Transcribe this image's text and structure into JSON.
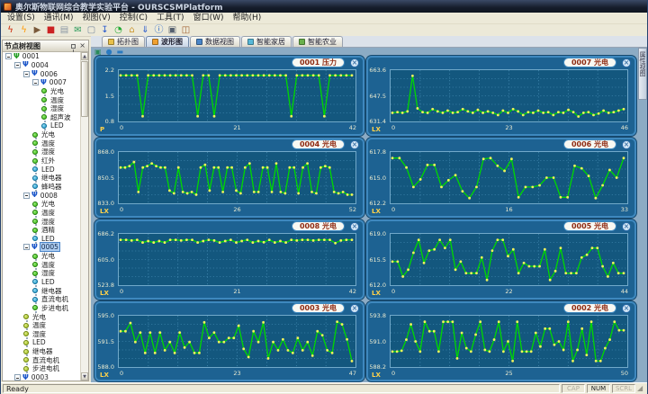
{
  "window": {
    "title": "奥尔斯物联网综合教学实验平台 - OURSCSMPlatform"
  },
  "menu_bar": {
    "items": [
      "设置(S)",
      "通讯(M)",
      "视图(V)",
      "控制(C)",
      "工具(T)",
      "窗口(W)",
      "帮助(H)"
    ]
  },
  "toolbar": {
    "icons": [
      {
        "name": "lightning-red-icon",
        "glyph": "ϟ",
        "color": "#cc2200"
      },
      {
        "name": "lightning-orange-icon",
        "glyph": "ϟ",
        "color": "#ff9900"
      },
      {
        "name": "play-icon",
        "glyph": "▶",
        "color": "#7a5a3a"
      },
      {
        "name": "stop-icon",
        "glyph": "■",
        "color": "#cc2222"
      },
      {
        "name": "cascade-windows-icon",
        "glyph": "▤",
        "color": "#8a96a4"
      },
      {
        "name": "mail-icon",
        "glyph": "✉",
        "color": "#2a9a5a"
      },
      {
        "name": "window-icon",
        "glyph": "▢",
        "color": "#7a8aa0"
      },
      {
        "name": "download-icon",
        "glyph": "↧",
        "color": "#2255cc"
      },
      {
        "name": "clock-icon",
        "glyph": "◔",
        "color": "#22aa33"
      },
      {
        "name": "home-icon",
        "glyph": "⌂",
        "color": "#cc9933"
      },
      {
        "name": "arrow-down-icon",
        "glyph": "⇓",
        "color": "#2255cc"
      },
      {
        "name": "info-icon",
        "glyph": "ⓘ",
        "color": "#2266cc"
      },
      {
        "name": "monitor-icon",
        "glyph": "▣",
        "color": "#55606e"
      },
      {
        "name": "exit-icon",
        "glyph": "◫",
        "color": "#a06030"
      }
    ]
  },
  "tabs": {
    "items": [
      {
        "label": "拓扑图",
        "active": false,
        "icon_name": "topology-tab-icon",
        "icon_color": "#e8c04a"
      },
      {
        "label": "波形图",
        "active": true,
        "icon_name": "waveform-tab-icon",
        "icon_color": "#f0a030"
      },
      {
        "label": "数据视图",
        "active": false,
        "icon_name": "dataview-tab-icon",
        "icon_color": "#4a86c8"
      },
      {
        "label": "智能家居",
        "active": false,
        "icon_name": "smarthome-tab-icon",
        "icon_color": "#58b8d8"
      },
      {
        "label": "智能农业",
        "active": false,
        "icon_name": "agriculture-tab-icon",
        "icon_color": "#6ab04c"
      }
    ]
  },
  "chart_toolbar": {
    "icons": [
      {
        "name": "display-icon",
        "glyph": "▣",
        "color": "#2a8a5a"
      },
      {
        "name": "globe-icon",
        "glyph": "●",
        "color": "#2a7ac0"
      },
      {
        "name": "collapse-icon",
        "glyph": "▬",
        "color": "#2a7ac0"
      }
    ]
  },
  "right_tab": {
    "label": "属性视图"
  },
  "tree": {
    "title": "节点树视图",
    "rows": [
      {
        "type": "node",
        "label": "0001",
        "level": 0,
        "icon": "antenna-green",
        "selected": false
      },
      {
        "type": "node",
        "label": "0004",
        "level": 1,
        "icon": "antenna-blue",
        "selected": false
      },
      {
        "type": "node",
        "label": "0006",
        "level": 2,
        "icon": "antenna-blue",
        "selected": false
      },
      {
        "type": "node",
        "label": "0007",
        "level": 3,
        "icon": "antenna-blue",
        "selected": false
      },
      {
        "type": "leaf",
        "label": "光电",
        "level": 4,
        "icon": "green"
      },
      {
        "type": "leaf",
        "label": "温度",
        "level": 4,
        "icon": "green"
      },
      {
        "type": "leaf",
        "label": "湿度",
        "level": 4,
        "icon": "green"
      },
      {
        "type": "leaf",
        "label": "超声波",
        "level": 4,
        "icon": "green"
      },
      {
        "type": "leaf",
        "label": "LED",
        "level": 4,
        "icon": "blue"
      },
      {
        "type": "leaf",
        "label": "光电",
        "level": 3,
        "icon": "green"
      },
      {
        "type": "leaf",
        "label": "温度",
        "level": 3,
        "icon": "green"
      },
      {
        "type": "leaf",
        "label": "湿度",
        "level": 3,
        "icon": "green"
      },
      {
        "type": "leaf",
        "label": "红外",
        "level": 3,
        "icon": "green"
      },
      {
        "type": "leaf",
        "label": "LED",
        "level": 3,
        "icon": "blue"
      },
      {
        "type": "leaf",
        "label": "继电器",
        "level": 3,
        "icon": "blue"
      },
      {
        "type": "leaf",
        "label": "蜂鸣器",
        "level": 3,
        "icon": "blue"
      },
      {
        "type": "node",
        "label": "0008",
        "level": 2,
        "icon": "antenna-blue",
        "selected": false
      },
      {
        "type": "leaf",
        "label": "光电",
        "level": 3,
        "icon": "green"
      },
      {
        "type": "leaf",
        "label": "温度",
        "level": 3,
        "icon": "green"
      },
      {
        "type": "leaf",
        "label": "湿度",
        "level": 3,
        "icon": "green"
      },
      {
        "type": "leaf",
        "label": "酒精",
        "level": 3,
        "icon": "green"
      },
      {
        "type": "leaf",
        "label": "LED",
        "level": 3,
        "icon": "blue"
      },
      {
        "type": "node",
        "label": "0005",
        "level": 2,
        "icon": "antenna-blue",
        "selected": true
      },
      {
        "type": "leaf",
        "label": "光电",
        "level": 3,
        "icon": "green"
      },
      {
        "type": "leaf",
        "label": "温度",
        "level": 3,
        "icon": "green"
      },
      {
        "type": "leaf",
        "label": "湿度",
        "level": 3,
        "icon": "green"
      },
      {
        "type": "leaf",
        "label": "LED",
        "level": 3,
        "icon": "blue"
      },
      {
        "type": "leaf",
        "label": "继电器",
        "level": 3,
        "icon": "blue"
      },
      {
        "type": "leaf",
        "label": "直流电机",
        "level": 3,
        "icon": "blue"
      },
      {
        "type": "leaf",
        "label": "步进电机",
        "level": 3,
        "icon": "green"
      },
      {
        "type": "leaf",
        "label": "光电",
        "level": 2,
        "icon": "yellow"
      },
      {
        "type": "leaf",
        "label": "温度",
        "level": 2,
        "icon": "yellow"
      },
      {
        "type": "leaf",
        "label": "湿度",
        "level": 2,
        "icon": "yellow"
      },
      {
        "type": "leaf",
        "label": "LED",
        "level": 2,
        "icon": "yellow"
      },
      {
        "type": "leaf",
        "label": "继电器",
        "level": 2,
        "icon": "yellow"
      },
      {
        "type": "leaf",
        "label": "直流电机",
        "level": 2,
        "icon": "yellow"
      },
      {
        "type": "leaf",
        "label": "步进电机",
        "level": 2,
        "icon": "yellow"
      },
      {
        "type": "node",
        "label": "0003",
        "level": 1,
        "icon": "antenna-blue",
        "selected": false
      }
    ]
  },
  "status_bar": {
    "left": "Ready",
    "indicators": [
      {
        "label": "CAP",
        "on": false
      },
      {
        "label": "NUM",
        "on": true
      },
      {
        "label": "SCRL",
        "on": false
      }
    ]
  },
  "chart_data": {
    "type": "line",
    "grid": true,
    "line_color": "#00d800",
    "marker_color": "#eef25c",
    "charts": [
      {
        "title": "0001 压力",
        "unit": "P",
        "ylim": [
          0.8,
          2.2
        ],
        "ytick_labels": [
          "2.2",
          "1.5",
          "0.8"
        ],
        "xtick_labels": [
          "0",
          "21",
          "42"
        ],
        "values": [
          2.1,
          2.1,
          2.1,
          2.1,
          0.9,
          2.1,
          2.1,
          2.1,
          2.1,
          2.1,
          2.1,
          2.1,
          2.1,
          2.1,
          0.9,
          2.1,
          2.1,
          0.9,
          2.1,
          2.1,
          2.1,
          2.1,
          2.1,
          2.1,
          2.1,
          2.1,
          2.1,
          2.1,
          2.1,
          2.1,
          2.1,
          0.9,
          2.1,
          2.1,
          2.1,
          2.1,
          2.1,
          0.9,
          2.1,
          2.1,
          2.1,
          2.1,
          2.1
        ]
      },
      {
        "title": "0007 光电",
        "unit": "LX",
        "ylim": [
          631.4,
          663.6
        ],
        "ytick_labels": [
          "663.6",
          "647.5",
          "631.4"
        ],
        "xtick_labels": [
          "0",
          "23",
          "46"
        ],
        "values": [
          636,
          636.5,
          636,
          637,
          661,
          639,
          636.5,
          636,
          638.5,
          637,
          636,
          637.5,
          636,
          636.5,
          638.5,
          637,
          636,
          638,
          636,
          637,
          636,
          634.5,
          637.5,
          636,
          638.5,
          637,
          634.5,
          636.5,
          636,
          637.5,
          636,
          636.5,
          634.5,
          636.5,
          636,
          638,
          636.5,
          633.5,
          636,
          636.5,
          634.5,
          635.5,
          637.5,
          636,
          636.5,
          637.5,
          638.5
        ]
      },
      {
        "title": "0004 光电",
        "unit": "LX",
        "ylim": [
          833.0,
          868.0
        ],
        "ytick_labels": [
          "868.0",
          "850.5",
          "833.0"
        ],
        "xtick_labels": [
          "0",
          "26",
          "52"
        ],
        "values": [
          858,
          858,
          859,
          862,
          840,
          858,
          859,
          861,
          859,
          858,
          858,
          841,
          839,
          858,
          840,
          839,
          840,
          838,
          858,
          860,
          841,
          858,
          858,
          840,
          858,
          858,
          841,
          839,
          858,
          861,
          840,
          840,
          858,
          858,
          840,
          861,
          840,
          839,
          858,
          858,
          839,
          858,
          861,
          840,
          839,
          858,
          859,
          858,
          840,
          839,
          840,
          838,
          838
        ]
      },
      {
        "title": "0006 光电",
        "unit": "LX",
        "ylim": [
          612.2,
          617.8
        ],
        "ytick_labels": [
          "617.8",
          "615.0",
          "612.2"
        ],
        "xtick_labels": [
          "0",
          "16",
          "33"
        ],
        "values": [
          617.3,
          617.3,
          616.2,
          613.9,
          614.8,
          616.5,
          616.5,
          613.9,
          614.7,
          615.3,
          613.4,
          612.6,
          613.9,
          617.2,
          617.3,
          616.4,
          615.8,
          617.2,
          612.7,
          613.9,
          613.9,
          614.1,
          615.0,
          615.0,
          612.7,
          612.7,
          616.4,
          616.1,
          615.2,
          612.6,
          614.1,
          615.9,
          615.0,
          617.3
        ]
      },
      {
        "title": "0008 光电",
        "unit": "LX",
        "ylim": [
          523.8,
          686.2
        ],
        "ytick_labels": [
          "686.2",
          "605.0",
          "523.8"
        ],
        "xtick_labels": [
          "0",
          "21",
          "42"
        ],
        "values": [
          672,
          672,
          670,
          672,
          663,
          668,
          663,
          668,
          663,
          672,
          672,
          670,
          672,
          672,
          663,
          668,
          672,
          670,
          663,
          668,
          672,
          663,
          668,
          672,
          663,
          668,
          664,
          672,
          663,
          668,
          663,
          672,
          670,
          672,
          672,
          670,
          672,
          672,
          672,
          661,
          670,
          672,
          672
        ]
      },
      {
        "title": "0005 光电",
        "unit": "LX",
        "ylim": [
          612.0,
          619.0
        ],
        "ytick_labels": [
          "619.0",
          "615.5",
          "612.0"
        ],
        "xtick_labels": [
          "0",
          "22",
          "44"
        ],
        "values": [
          615.2,
          615.2,
          613,
          614,
          616.5,
          618.4,
          615,
          616.8,
          617,
          618.4,
          617.2,
          618.4,
          614,
          615.2,
          613.5,
          613.5,
          613.5,
          615.8,
          612.5,
          616.8,
          618.4,
          618.4,
          616,
          617,
          613.5,
          615,
          614.5,
          614.5,
          614.5,
          617,
          612.5,
          613.8,
          617.2,
          613.5,
          613.5,
          613.5,
          615.8,
          616.2,
          617.2,
          617.2,
          614.5,
          613,
          615,
          613.5,
          613.5
        ]
      },
      {
        "title": "0003 光电",
        "unit": "LX",
        "ylim": [
          588.0,
          595.0
        ],
        "ytick_labels": [
          "595.0",
          "591.5",
          "588.0"
        ],
        "xtick_labels": [
          "0",
          "23",
          "47"
        ],
        "values": [
          593,
          593,
          594.2,
          591.4,
          592.8,
          589.8,
          592.8,
          589.8,
          592.8,
          590.2,
          591.4,
          589.8,
          592.8,
          590.6,
          591.4,
          589.8,
          589.8,
          594.3,
          592,
          592.8,
          591.4,
          591.4,
          592,
          592,
          593.8,
          590.4,
          589.2,
          593,
          591.4,
          594.3,
          589,
          591.4,
          590.2,
          591.8,
          590.2,
          589.8,
          592,
          590.2,
          591.4,
          589.4,
          593,
          592.4,
          590.2,
          589.8,
          594.4,
          594,
          591.8,
          588.6
        ]
      },
      {
        "title": "0002 光电",
        "unit": "LX",
        "ylim": [
          588.2,
          593.8
        ],
        "ytick_labels": [
          "593.8",
          "591.0",
          "588.2"
        ],
        "xtick_labels": [
          "0",
          "25",
          "50"
        ],
        "values": [
          589.8,
          589.8,
          589.9,
          591.2,
          593,
          591,
          589.8,
          593.3,
          592.2,
          592.2,
          589.8,
          593.3,
          593.3,
          593.3,
          589,
          592,
          590.2,
          589.8,
          591.8,
          593.3,
          590,
          589.8,
          591.2,
          593.3,
          589.8,
          591,
          588.7,
          593.3,
          589.8,
          589.8,
          589.8,
          592,
          590.4,
          592.5,
          592.5,
          590.6,
          591,
          590,
          593.3,
          588.7,
          590,
          592.5,
          589.4,
          593.3,
          588.7,
          588.7,
          590.2,
          591.2,
          593.3,
          592.3,
          592.3
        ]
      }
    ]
  }
}
